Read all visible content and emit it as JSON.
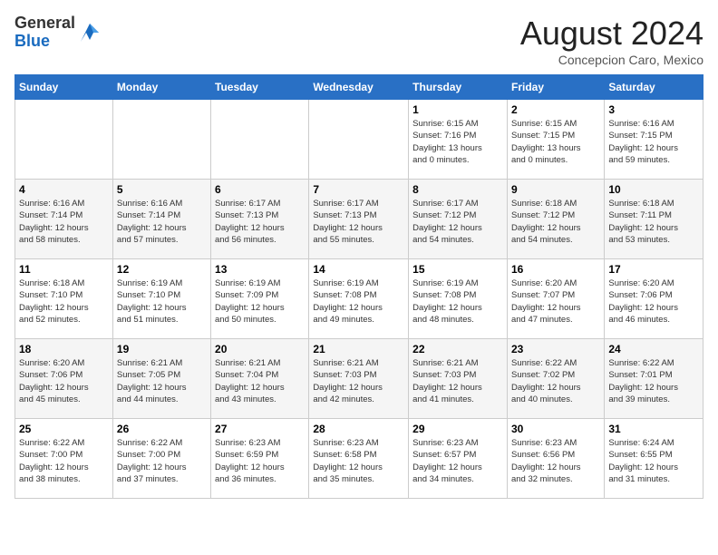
{
  "logo": {
    "general": "General",
    "blue": "Blue"
  },
  "header": {
    "month_year": "August 2024",
    "location": "Concepcion Caro, Mexico"
  },
  "days_of_week": [
    "Sunday",
    "Monday",
    "Tuesday",
    "Wednesday",
    "Thursday",
    "Friday",
    "Saturday"
  ],
  "weeks": [
    [
      {
        "day": "",
        "info": ""
      },
      {
        "day": "",
        "info": ""
      },
      {
        "day": "",
        "info": ""
      },
      {
        "day": "",
        "info": ""
      },
      {
        "day": "1",
        "info": "Sunrise: 6:15 AM\nSunset: 7:16 PM\nDaylight: 13 hours\nand 0 minutes."
      },
      {
        "day": "2",
        "info": "Sunrise: 6:15 AM\nSunset: 7:15 PM\nDaylight: 13 hours\nand 0 minutes."
      },
      {
        "day": "3",
        "info": "Sunrise: 6:16 AM\nSunset: 7:15 PM\nDaylight: 12 hours\nand 59 minutes."
      }
    ],
    [
      {
        "day": "4",
        "info": "Sunrise: 6:16 AM\nSunset: 7:14 PM\nDaylight: 12 hours\nand 58 minutes."
      },
      {
        "day": "5",
        "info": "Sunrise: 6:16 AM\nSunset: 7:14 PM\nDaylight: 12 hours\nand 57 minutes."
      },
      {
        "day": "6",
        "info": "Sunrise: 6:17 AM\nSunset: 7:13 PM\nDaylight: 12 hours\nand 56 minutes."
      },
      {
        "day": "7",
        "info": "Sunrise: 6:17 AM\nSunset: 7:13 PM\nDaylight: 12 hours\nand 55 minutes."
      },
      {
        "day": "8",
        "info": "Sunrise: 6:17 AM\nSunset: 7:12 PM\nDaylight: 12 hours\nand 54 minutes."
      },
      {
        "day": "9",
        "info": "Sunrise: 6:18 AM\nSunset: 7:12 PM\nDaylight: 12 hours\nand 54 minutes."
      },
      {
        "day": "10",
        "info": "Sunrise: 6:18 AM\nSunset: 7:11 PM\nDaylight: 12 hours\nand 53 minutes."
      }
    ],
    [
      {
        "day": "11",
        "info": "Sunrise: 6:18 AM\nSunset: 7:10 PM\nDaylight: 12 hours\nand 52 minutes."
      },
      {
        "day": "12",
        "info": "Sunrise: 6:19 AM\nSunset: 7:10 PM\nDaylight: 12 hours\nand 51 minutes."
      },
      {
        "day": "13",
        "info": "Sunrise: 6:19 AM\nSunset: 7:09 PM\nDaylight: 12 hours\nand 50 minutes."
      },
      {
        "day": "14",
        "info": "Sunrise: 6:19 AM\nSunset: 7:08 PM\nDaylight: 12 hours\nand 49 minutes."
      },
      {
        "day": "15",
        "info": "Sunrise: 6:19 AM\nSunset: 7:08 PM\nDaylight: 12 hours\nand 48 minutes."
      },
      {
        "day": "16",
        "info": "Sunrise: 6:20 AM\nSunset: 7:07 PM\nDaylight: 12 hours\nand 47 minutes."
      },
      {
        "day": "17",
        "info": "Sunrise: 6:20 AM\nSunset: 7:06 PM\nDaylight: 12 hours\nand 46 minutes."
      }
    ],
    [
      {
        "day": "18",
        "info": "Sunrise: 6:20 AM\nSunset: 7:06 PM\nDaylight: 12 hours\nand 45 minutes."
      },
      {
        "day": "19",
        "info": "Sunrise: 6:21 AM\nSunset: 7:05 PM\nDaylight: 12 hours\nand 44 minutes."
      },
      {
        "day": "20",
        "info": "Sunrise: 6:21 AM\nSunset: 7:04 PM\nDaylight: 12 hours\nand 43 minutes."
      },
      {
        "day": "21",
        "info": "Sunrise: 6:21 AM\nSunset: 7:03 PM\nDaylight: 12 hours\nand 42 minutes."
      },
      {
        "day": "22",
        "info": "Sunrise: 6:21 AM\nSunset: 7:03 PM\nDaylight: 12 hours\nand 41 minutes."
      },
      {
        "day": "23",
        "info": "Sunrise: 6:22 AM\nSunset: 7:02 PM\nDaylight: 12 hours\nand 40 minutes."
      },
      {
        "day": "24",
        "info": "Sunrise: 6:22 AM\nSunset: 7:01 PM\nDaylight: 12 hours\nand 39 minutes."
      }
    ],
    [
      {
        "day": "25",
        "info": "Sunrise: 6:22 AM\nSunset: 7:00 PM\nDaylight: 12 hours\nand 38 minutes."
      },
      {
        "day": "26",
        "info": "Sunrise: 6:22 AM\nSunset: 7:00 PM\nDaylight: 12 hours\nand 37 minutes."
      },
      {
        "day": "27",
        "info": "Sunrise: 6:23 AM\nSunset: 6:59 PM\nDaylight: 12 hours\nand 36 minutes."
      },
      {
        "day": "28",
        "info": "Sunrise: 6:23 AM\nSunset: 6:58 PM\nDaylight: 12 hours\nand 35 minutes."
      },
      {
        "day": "29",
        "info": "Sunrise: 6:23 AM\nSunset: 6:57 PM\nDaylight: 12 hours\nand 34 minutes."
      },
      {
        "day": "30",
        "info": "Sunrise: 6:23 AM\nSunset: 6:56 PM\nDaylight: 12 hours\nand 32 minutes."
      },
      {
        "day": "31",
        "info": "Sunrise: 6:24 AM\nSunset: 6:55 PM\nDaylight: 12 hours\nand 31 minutes."
      }
    ]
  ]
}
